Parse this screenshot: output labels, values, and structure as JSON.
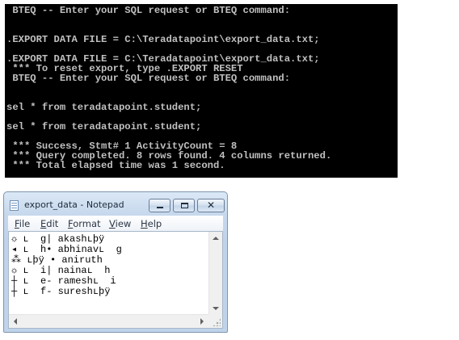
{
  "console": {
    "lines": [
      " BTEQ -- Enter your SQL request or BTEQ command:",
      "",
      "",
      ".EXPORT DATA FILE = C:\\Teradatapoint\\export_data.txt;",
      "",
      ".EXPORT DATA FILE = C:\\Teradatapoint\\export_data.txt;",
      " *** To reset export, type .EXPORT RESET",
      " BTEQ -- Enter your SQL request or BTEQ command:",
      "",
      "",
      "sel * from teradatapoint.student;",
      "",
      "sel * from teradatapoint.student;",
      "",
      " *** Success, Stmt# 1 ActivityCount = 8",
      " *** Query completed. 8 rows found. 4 columns returned.",
      " *** Total elapsed time was 1 second."
    ]
  },
  "notepad": {
    "title": "export_data - Notepad",
    "close_glyph": "✕",
    "menu": [
      {
        "acc": "F",
        "rest": "ile"
      },
      {
        "acc": "E",
        "rest": "dit"
      },
      {
        "acc": "F",
        "rest": "ormat"
      },
      {
        "acc": "V",
        "rest": "iew"
      },
      {
        "acc": "H",
        "rest": "elp"
      }
    ],
    "document_lines": [
      "☼ ʟ  g| akashʟþÿ",
      "◂ ʟ  h• abhinavʟ  g",
      "⁂ ʟþÿ • aniruth",
      "☼ ʟ  i| nainaʟ  h",
      "┼ ʟ  e- rameshʟ  i",
      "┼ ʟ  f- sureshʟþÿ"
    ]
  },
  "colors": {
    "console_bg": "#000000",
    "console_fg": "#c0c0c0",
    "window_frame": "#c6d8ec"
  }
}
